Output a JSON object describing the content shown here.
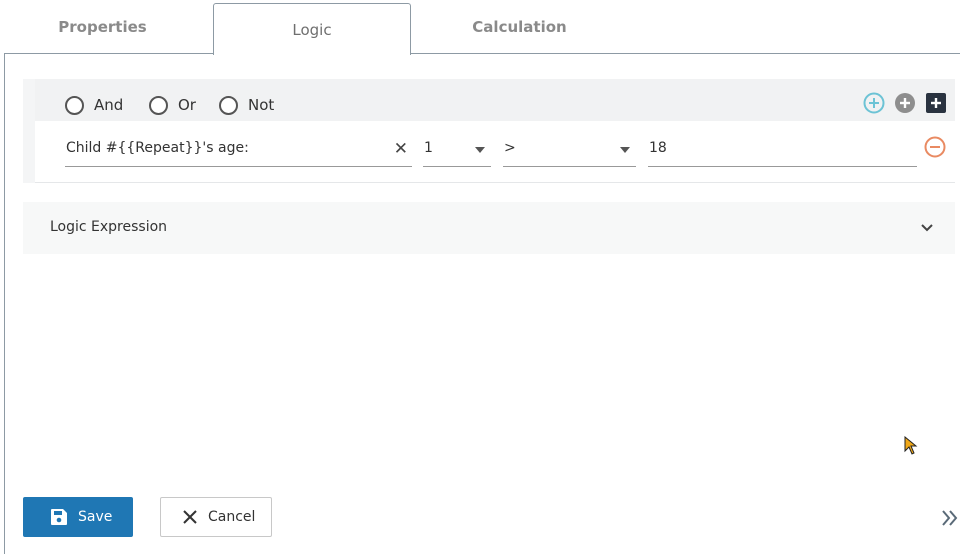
{
  "tabs": [
    {
      "label": "Properties"
    },
    {
      "label": "Logic"
    },
    {
      "label": "Calculation"
    }
  ],
  "logic": {
    "operators": [
      {
        "label": "And",
        "checked": false
      },
      {
        "label": "Or",
        "checked": false
      },
      {
        "label": "Not",
        "checked": false
      }
    ],
    "condition": {
      "field_value": "Child #{{Repeat}}'s age:",
      "instance_value": "1",
      "operator_value": ">",
      "compare_value": "18"
    }
  },
  "expression": {
    "label": "Logic Expression"
  },
  "actions": {
    "save_label": "Save",
    "cancel_label": "Cancel"
  },
  "icons": {
    "add_condition": "plus-circle-outline-icon",
    "add_group": "plus-circle-filled-icon",
    "add_block": "plus-square-icon",
    "remove_condition": "minus-circle-icon",
    "expand_sidebar": "double-chevron-right-icon"
  },
  "colors": {
    "accent": "#1f77b4",
    "add_outline": "#6cc3d5",
    "remove": "#e98a62",
    "tab_border": "#8d9aa4"
  }
}
